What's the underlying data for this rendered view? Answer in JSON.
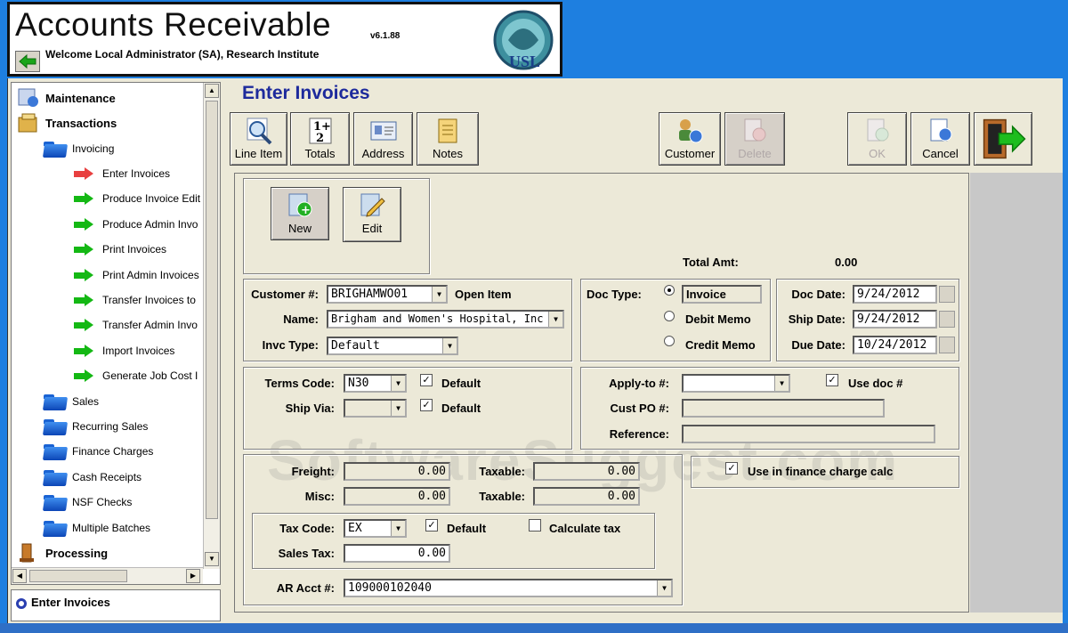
{
  "header": {
    "title": "Accounts Receivable",
    "version": "v6.1.88",
    "welcome": "Welcome Local Administrator (SA), Research Institute"
  },
  "tree": {
    "items": [
      {
        "label": "Maintenance"
      },
      {
        "label": "Transactions"
      },
      {
        "label": "Invoicing"
      },
      {
        "label": "Enter Invoices"
      },
      {
        "label": "Produce Invoice Edit"
      },
      {
        "label": "Produce Admin Invo"
      },
      {
        "label": "Print Invoices"
      },
      {
        "label": "Print Admin Invoices"
      },
      {
        "label": "Transfer Invoices to"
      },
      {
        "label": "Transfer Admin Invo"
      },
      {
        "label": "Import Invoices"
      },
      {
        "label": "Generate Job Cost I"
      },
      {
        "label": "Sales"
      },
      {
        "label": "Recurring Sales"
      },
      {
        "label": "Finance Charges"
      },
      {
        "label": "Cash Receipts"
      },
      {
        "label": "NSF Checks"
      },
      {
        "label": "Multiple Batches"
      },
      {
        "label": "Processing"
      }
    ]
  },
  "status": {
    "text": "Enter Invoices"
  },
  "page": {
    "heading": "Enter Invoices"
  },
  "toolbar": {
    "line_item": "Line Item",
    "totals": "Totals",
    "address": "Address",
    "notes": "Notes",
    "customer": "Customer",
    "delete": "Delete",
    "ok": "OK",
    "cancel": "Cancel"
  },
  "actions": {
    "new": "New",
    "edit": "Edit"
  },
  "totals": {
    "label": "Total Amt:",
    "value": "0.00"
  },
  "customer": {
    "number_label": "Customer #:",
    "number_value": "BRIGHAMWO01",
    "open_item": "Open Item",
    "name_label": "Name:",
    "name_value": "Brigham and Women's Hospital, Inc",
    "type_label": "Invc Type:",
    "type_value": "Default"
  },
  "doc_type": {
    "label": "Doc Type:",
    "options": [
      "Invoice",
      "Debit Memo",
      "Credit Memo"
    ],
    "selected": "Invoice"
  },
  "dates": {
    "doc_label": "Doc Date:",
    "doc_value": "9/24/2012",
    "ship_label": "Ship Date:",
    "ship_value": "9/24/2012",
    "due_label": "Due Date:",
    "due_value": "10/24/2012"
  },
  "terms": {
    "terms_label": "Terms Code:",
    "terms_value": "N30",
    "ship_via_label": "Ship Via:",
    "ship_via_value": "",
    "default_label": "Default"
  },
  "apply": {
    "apply_label": "Apply-to #:",
    "apply_value": "",
    "use_doc_label": "Use doc #",
    "cust_po_label": "Cust PO #:",
    "cust_po_value": "",
    "reference_label": "Reference:",
    "reference_value": ""
  },
  "charges": {
    "freight_label": "Freight:",
    "freight_value": "0.00",
    "misc_label": "Misc:",
    "misc_value": "0.00",
    "taxable_label": "Taxable:",
    "taxable1_value": "0.00",
    "taxable2_value": "0.00"
  },
  "finance": {
    "use_label": "Use in finance charge calc"
  },
  "tax": {
    "code_label": "Tax Code:",
    "code_value": "EX",
    "default_label": "Default",
    "calc_label": "Calculate tax",
    "sales_tax_label": "Sales Tax:",
    "sales_tax_value": "0.00"
  },
  "ar": {
    "label": "AR Acct #:",
    "value": "109000102040"
  },
  "watermark": "SoftwareSuggest.com"
}
